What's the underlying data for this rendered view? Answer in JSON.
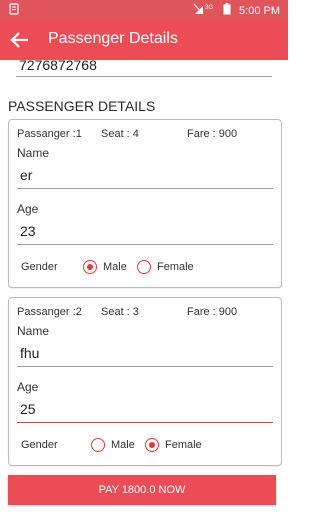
{
  "status_bar": {
    "time": "5:00 PM",
    "network_label": "3G"
  },
  "app_bar": {
    "title": "Passenger Details"
  },
  "contact": {
    "phone": "7276872768"
  },
  "section_title": "PASSENGER DETAILS",
  "passengers": [
    {
      "passenger_label": "Passanger :1",
      "seat_label": "Seat : 4",
      "fare_label": "Fare : 900",
      "name_label": "Name",
      "name_value": "er",
      "age_label": "Age",
      "age_value": "23",
      "gender_label": "Gender",
      "male_label": "Male",
      "female_label": "Female",
      "gender_selected": "Male"
    },
    {
      "passenger_label": "Passanger :2",
      "seat_label": "Seat : 3",
      "fare_label": "Fare : 900",
      "name_label": "Name",
      "name_value": "fhu",
      "age_label": "Age",
      "age_value": "25",
      "gender_label": "Gender",
      "male_label": "Male",
      "female_label": "Female",
      "gender_selected": "Female"
    }
  ],
  "pay_button_label": "PAY 1800.0 NOW",
  "colors": {
    "primary": "#ec4c55",
    "status_bar": "#e0555c",
    "accent": "#e53935"
  }
}
